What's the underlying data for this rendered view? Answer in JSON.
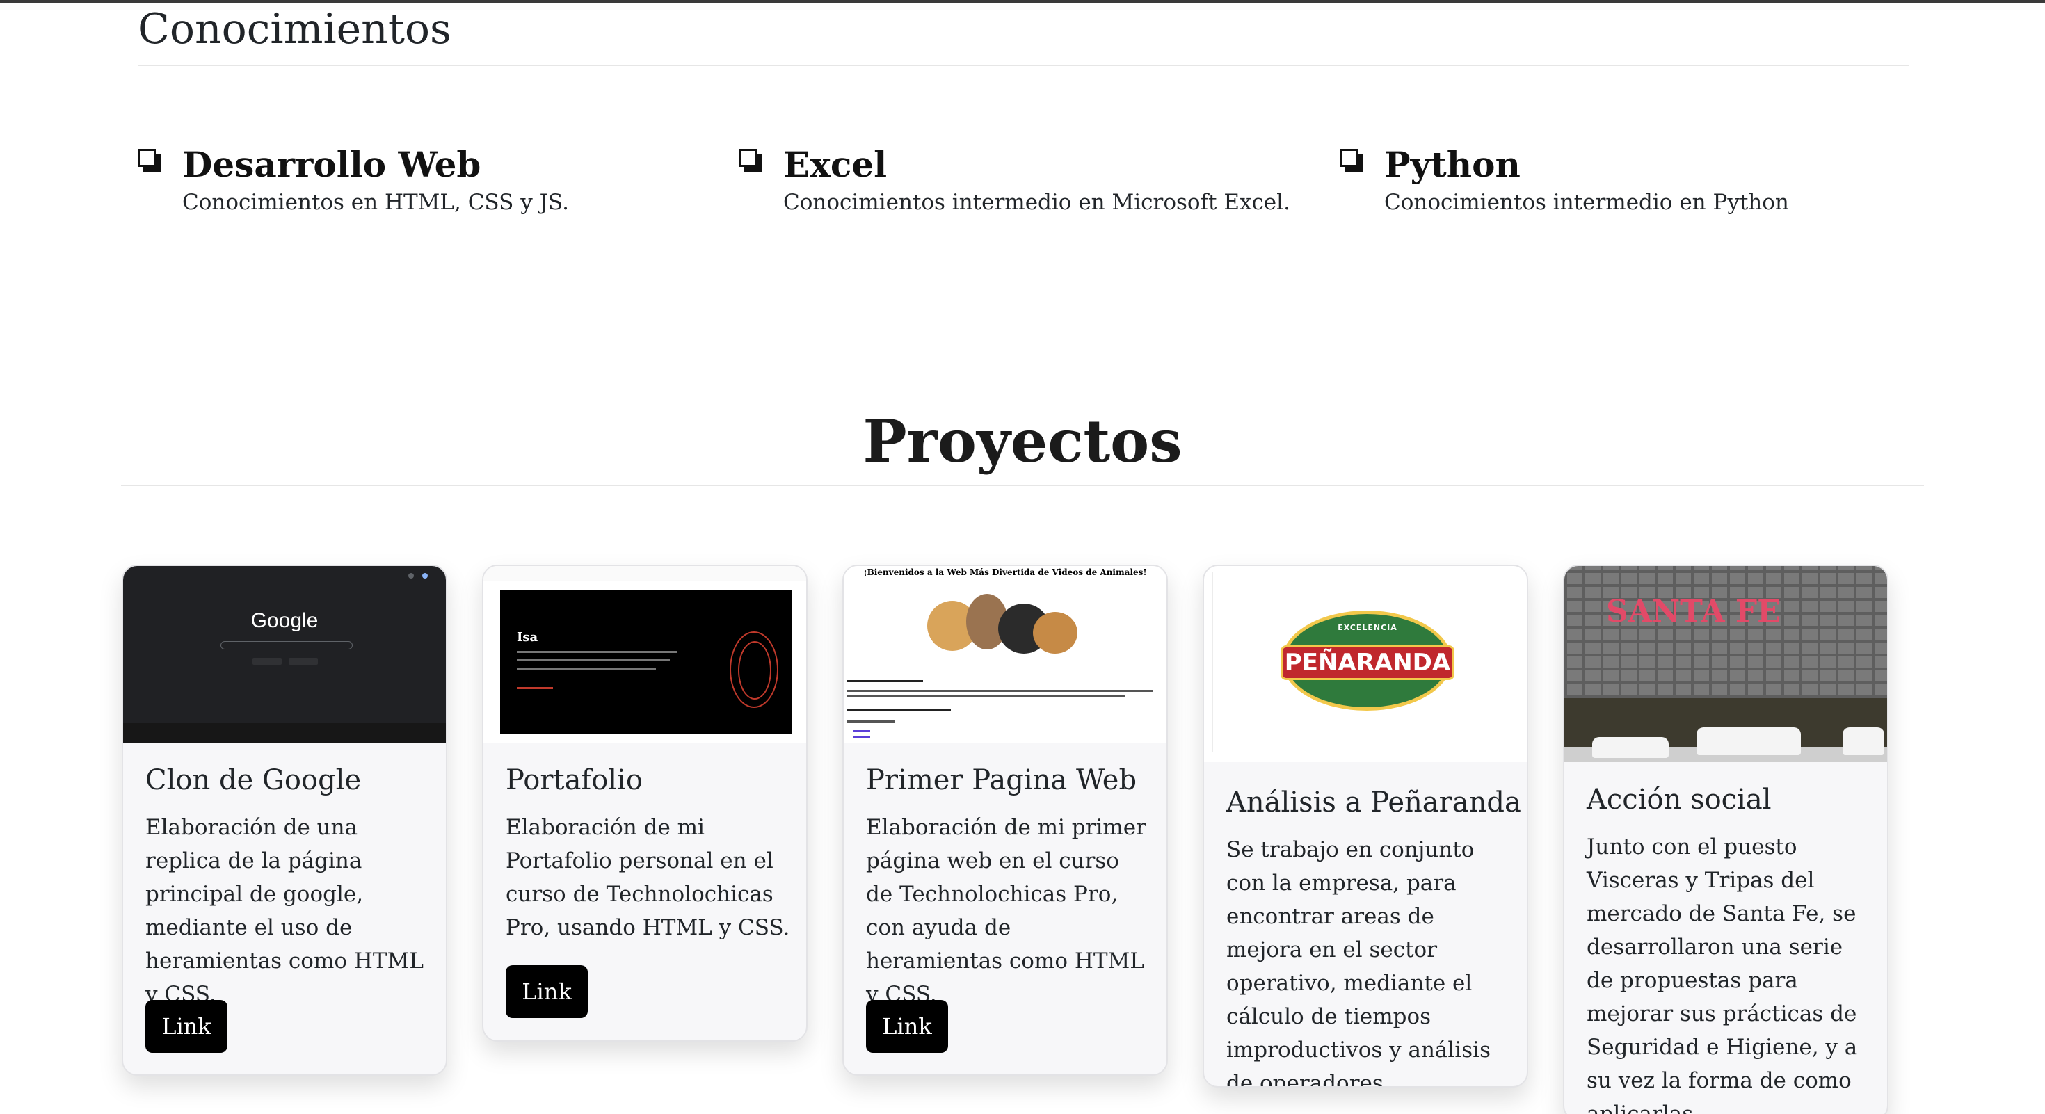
{
  "knowledge": {
    "title": "Conocimientos",
    "items": [
      {
        "title": "Desarrollo Web",
        "desc": "Conocimientos en HTML, CSS y JS.",
        "icon": "copy-squares-icon"
      },
      {
        "title": "Excel",
        "desc": "Conocimientos intermedio en Microsoft Excel.",
        "icon": "copy-squares-icon"
      },
      {
        "title": "Python",
        "desc": "Conocimientos intermedio en Python",
        "icon": "copy-squares-icon"
      }
    ]
  },
  "projects": {
    "title": "Proyectos",
    "cards": [
      {
        "title": "Clon de Google",
        "desc": "Elaboración de una replica de la página principal de google, mediante el uso de heramientas como HTML y CSS.",
        "button": "Link",
        "thumb_text": "Google"
      },
      {
        "title": "Portafolio",
        "desc": "Elaboración de mi Portafolio personal en el curso de Technolochicas Pro, usando HTML y CSS.",
        "button": "Link",
        "thumb_text": "Isa"
      },
      {
        "title": "Primer Pagina Web",
        "desc": "Elaboración de mi primer página web en el curso de Technolochicas Pro, con ayuda de heramientas como HTML y CSS.",
        "button": "Link",
        "thumb_text": "¡Bienvenidos a la Web Más Divertida de Videos de Animales!"
      },
      {
        "title": "Análisis a Peñaranda",
        "desc": "Se trabajo en conjunto con la empresa, para encontrar areas de mejora en el sector operativo, mediante el cálculo de tiempos improductivos y análisis de operadores.",
        "thumb_text": "PEÑARANDA",
        "thumb_sub": "EXCELENCIA"
      },
      {
        "title": "Acción social",
        "desc": "Junto con el puesto Visceras y Tripas del mercado de Santa Fe, se desarrollaron una serie de propuestas para mejorar sus prácticas de Seguridad e Higiene, y a su vez la forma de como aplicarlas.",
        "thumb_text": "SANTA FE"
      }
    ]
  },
  "colors": {
    "accent": "#000000",
    "text": "#212529",
    "card_bg": "#f7f7f9"
  }
}
